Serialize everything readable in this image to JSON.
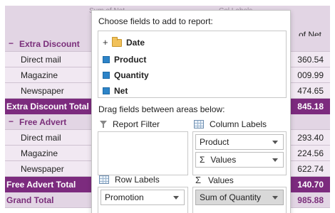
{
  "grid": {
    "header": {
      "faded_left": "Sum of Net",
      "faded_right": "Col Labels",
      "net_label": "of Net"
    },
    "rows": [
      {
        "kind": "group",
        "label": "Extra Discount",
        "toggle": "−",
        "value": ""
      },
      {
        "kind": "detail",
        "label": "Direct mail",
        "value": "360.54"
      },
      {
        "kind": "detail",
        "label": "Magazine",
        "value": "009.99"
      },
      {
        "kind": "detail",
        "label": "Newspaper",
        "value": "474.65"
      },
      {
        "kind": "total",
        "label": "Extra Discount Total",
        "value": "845.18"
      },
      {
        "kind": "group",
        "label": "Free Advert",
        "toggle": "−",
        "value": ""
      },
      {
        "kind": "detail",
        "label": "Direct mail",
        "value": "293.40"
      },
      {
        "kind": "detail",
        "label": "Magazine",
        "value": "224.56"
      },
      {
        "kind": "detail",
        "label": "Newspaper",
        "value": "622.74"
      },
      {
        "kind": "total",
        "label": "Free Advert Total",
        "value": "140.70"
      },
      {
        "kind": "grand",
        "label": "Grand Total",
        "value": "985.88"
      }
    ]
  },
  "field_list": {
    "choose_caption": "Choose fields to add to report:",
    "fields": [
      {
        "label": "Date",
        "type": "folder",
        "expander": "+"
      },
      {
        "label": "Product",
        "type": "checkbox",
        "checked": true
      },
      {
        "label": "Quantity",
        "type": "checkbox",
        "checked": true
      },
      {
        "label": "Net",
        "type": "checkbox",
        "checked": true
      }
    ],
    "drag_caption": "Drag fields between areas below:",
    "areas": {
      "report_filter": {
        "title": "Report Filter",
        "items": []
      },
      "column_labels": {
        "title": "Column Labels",
        "items": [
          "Product",
          "Values"
        ]
      },
      "row_labels": {
        "title": "Row Labels",
        "items": [
          "Promotion"
        ]
      },
      "values": {
        "title": "Values",
        "items": [
          "Sum of Quantity"
        ]
      }
    },
    "sigma": "Σ"
  },
  "colors": {
    "accent": "#7c2b7e",
    "group_bg": "#e2d5e4",
    "detail_bg": "#f1e8f2",
    "checkbox": "#2d84c8"
  }
}
